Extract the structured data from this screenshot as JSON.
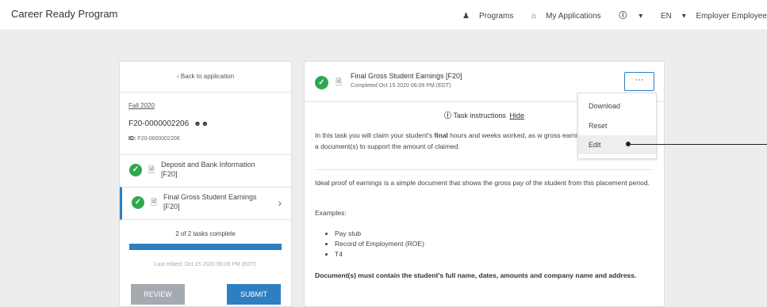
{
  "header": {
    "brand": "Career Ready Program",
    "nav": {
      "programs": "Programs",
      "my_applications": "My Applications",
      "info_caret": "▾",
      "language": "EN",
      "language_caret": "▾",
      "user": "Employer Employee"
    }
  },
  "sidebar": {
    "back_label": "Back to application",
    "term": "Fall 2020",
    "application_number": "F20-0000002206",
    "id_label": "ID:",
    "id_value": "F20-0000002206",
    "tasks": [
      {
        "label": "Deposit and Bank Information [F20]",
        "status": "complete"
      },
      {
        "label": "Final Gross Student Earnings [F20]",
        "status": "complete",
        "active": true
      }
    ],
    "progress_text": "2 of 2 tasks complete",
    "progress_fraction": 1.0,
    "last_edited": "Last edited: Oct 15 2020 06:09 PM (EDT)",
    "review_label": "REVIEW",
    "submit_label": "SUBMIT"
  },
  "task": {
    "title": "Final Gross Student Earnings [F20]",
    "completed": "Completed Oct 15 2020 06:09 PM (EDT)",
    "more_label": "···",
    "instructions_label": "Task instructions",
    "hide_label": "Hide",
    "para1_pre": "In this task you will claim your student's ",
    "para1_bold": "final",
    "para1_post": " hours and weeks worked, as w gross earnings. You will also upload a document(s) to support the amount of claimed.",
    "para2": "Ideal proof of earnings is a simple document that shows the gross pay of the student from this placement period.",
    "examples_label": "Examples:",
    "examples": [
      "Pay stub",
      "Record of Employment (ROE)",
      "T4"
    ],
    "para4": "Document(s) must contain the student's full name, dates, amounts and company name and address."
  },
  "menu": {
    "items": [
      "Download",
      "Reset",
      "Edit"
    ],
    "highlighted": "Edit"
  },
  "colors": {
    "accent": "#2e7fc1",
    "success": "#2fa84f",
    "review_button": "#a4aab0"
  }
}
